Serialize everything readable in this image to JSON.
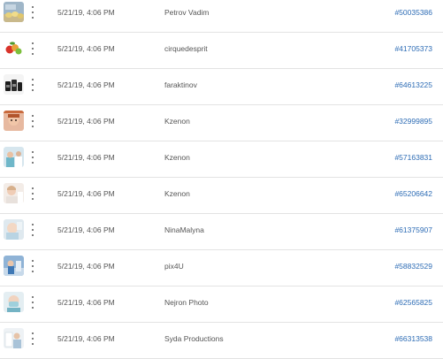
{
  "rows": [
    {
      "thumb_icon": "yellow-flowers-thumbnail",
      "date": "5/21/19, 4:06 PM",
      "author": "Petrov Vadim",
      "id": "#50035386"
    },
    {
      "thumb_icon": "fruit-thumbnail",
      "date": "5/21/19, 4:06 PM",
      "author": "cirquedesprit",
      "id": "#41705373"
    },
    {
      "thumb_icon": "supplement-bottles-thumbnail",
      "date": "5/21/19, 4:06 PM",
      "author": "faraktinov",
      "id": "#64613225"
    },
    {
      "thumb_icon": "woman-portrait-thumbnail",
      "date": "5/21/19, 4:06 PM",
      "author": "Kzenon",
      "id": "#32999895"
    },
    {
      "thumb_icon": "medical-staff-thumbnail",
      "date": "5/21/19, 4:06 PM",
      "author": "Kzenon",
      "id": "#57163831"
    },
    {
      "thumb_icon": "doctor-patient-thumbnail",
      "date": "5/21/19, 4:06 PM",
      "author": "Kzenon",
      "id": "#65206642"
    },
    {
      "thumb_icon": "dental-care-thumbnail",
      "date": "5/21/19, 4:06 PM",
      "author": "NinaMalyna",
      "id": "#61375907"
    },
    {
      "thumb_icon": "hospital-scene-thumbnail",
      "date": "5/21/19, 4:06 PM",
      "author": "pix4U",
      "id": "#58832529"
    },
    {
      "thumb_icon": "surgeon-mask-thumbnail",
      "date": "5/21/19, 4:06 PM",
      "author": "Nejron Photo",
      "id": "#62565825"
    },
    {
      "thumb_icon": "medical-exam-thumbnail",
      "date": "5/21/19, 4:06 PM",
      "author": "Syda Productions",
      "id": "#66313538"
    }
  ],
  "colors": {
    "id_link": "#2d6cb5",
    "row_divider": "#e3e3e3",
    "text": "#555555"
  }
}
